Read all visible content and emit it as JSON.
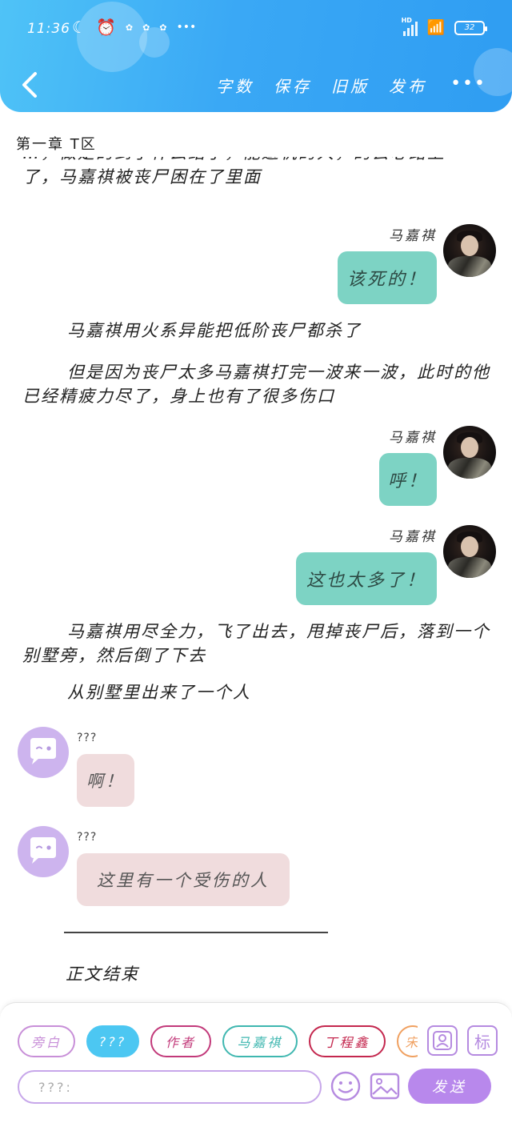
{
  "status_bar": {
    "time": "11:36",
    "left_icons": [
      "moon-icon",
      "alarm-icon",
      "app-notification-icon",
      "app-notification-icon",
      "app-notification-icon"
    ],
    "more": "•••",
    "network": "HD",
    "battery": "32"
  },
  "header": {
    "actions": [
      "字数",
      "保存",
      "旧版",
      "发布"
    ],
    "more": "•••"
  },
  "chapter_title": "第一章 T区",
  "content": {
    "para_top_partial": "…，做是的到了什么结了，能避机的人，的去心路上",
    "para_top": "了，马嘉祺被丧尸困在了里面",
    "msg1": {
      "speaker": "马嘉祺",
      "text": "该死的！"
    },
    "para2": "马嘉祺用火系异能把低阶丧尸都杀了",
    "para3": "但是因为丧尸太多马嘉祺打完一波来一波，此时的他已经精疲力尽了，身上也有了很多伤口",
    "msg2": {
      "speaker": "马嘉祺",
      "text": "呼！"
    },
    "msg3": {
      "speaker": "马嘉祺",
      "text": "这也太多了！"
    },
    "para4": "马嘉祺用尽全力，飞了出去，甩掉丧尸后，落到一个别墅旁，然后倒了下去",
    "para5": "从别墅里出来了一个人",
    "msg4": {
      "speaker": "???",
      "text": "啊！"
    },
    "msg5": {
      "speaker": "???",
      "text": "这里有一个受伤的人"
    },
    "divider": "——————————————————",
    "ending": "正文结束"
  },
  "composer": {
    "roles": [
      {
        "label": "旁白",
        "color": "#c88fd8"
      },
      {
        "label": "???",
        "color": "#4cc7f2",
        "selected": true
      },
      {
        "label": "作者",
        "color": "#c2397a"
      },
      {
        "label": "马嘉祺",
        "color": "#3fb7b0"
      },
      {
        "label": "丁程鑫",
        "color": "#c4274e"
      },
      {
        "label": "宋",
        "color": "#f0a060"
      }
    ],
    "tools": [
      "character-manage-icon",
      "tag-icon"
    ],
    "tag_label": "标",
    "input_placeholder": "???:",
    "send_label": "发送",
    "colors": {
      "accent": "#b888ec",
      "input_border": "#c7a7ea"
    }
  }
}
